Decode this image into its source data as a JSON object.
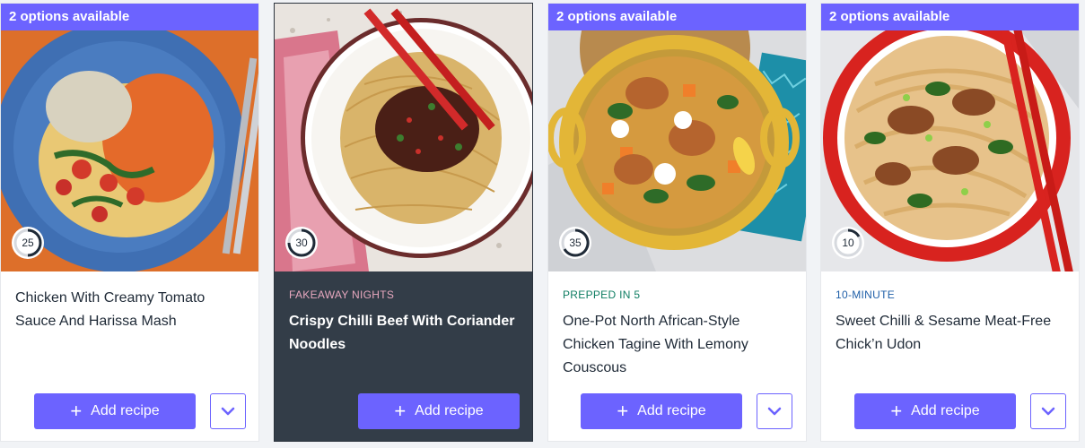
{
  "cards": [
    {
      "badge": "2 options available",
      "time": "25",
      "tag": "",
      "title": "Chicken With Creamy Tomato Sauce And Harissa Mash",
      "add_label": "Add recipe"
    },
    {
      "badge": "",
      "time": "30",
      "tag": "FAKEAWAY NIGHTS",
      "title": "Crispy Chilli Beef With Coriander Noodles",
      "add_label": "Add recipe"
    },
    {
      "badge": "2 options available",
      "time": "35",
      "tag": "PREPPED IN 5",
      "title": "One-Pot North African-Style Chicken Tagine With Lemony Couscous",
      "add_label": "Add recipe"
    },
    {
      "badge": "2 options available",
      "time": "10",
      "tag": "10-MINUTE",
      "title": "Sweet Chilli & Sesame Meat-Free Chick’n Udon",
      "add_label": "Add recipe"
    }
  ],
  "colors": {
    "accent": "#6c63ff",
    "featured_card_bg": "#333d48",
    "tag_fakeaway": "#e8a8bf",
    "tag_prepped": "#0e7d62",
    "tag_quick": "#1f5fa8"
  },
  "icons": {
    "add": "plus-icon",
    "more": "chevron-down-icon",
    "timer": "clock-ring-icon"
  }
}
